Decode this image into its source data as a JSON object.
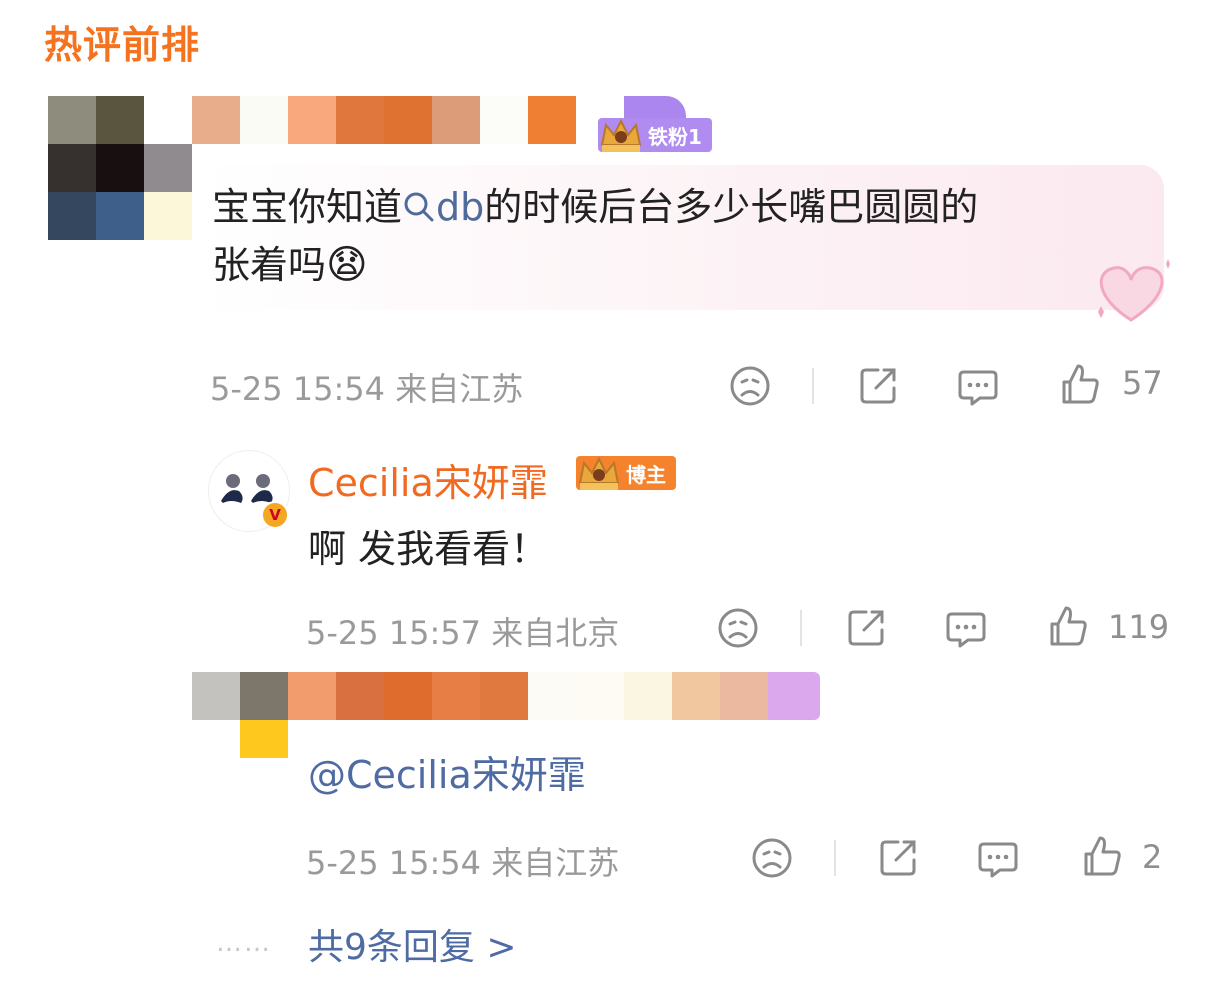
{
  "section_title": "热评前排",
  "comments": [
    {
      "badge_label": "铁粉1",
      "text_before": "宝宝你知道",
      "topic": "db",
      "text_after": "的时候后台多少长嘴巴圆圆的",
      "text_line2": "张着吗",
      "emoji": "😧",
      "time": "5-25 15:54",
      "location": "来自江苏",
      "likes": "57"
    },
    {
      "user_name": "Cecilia宋妍霏",
      "badge_label": "博主",
      "verified_mark": "V",
      "text": "啊 发我看看！",
      "time": "5-25 15:57",
      "location": "来自北京",
      "likes": "119"
    },
    {
      "mention": "@Cecilia宋妍霏",
      "time": "5-25 15:54",
      "location": "来自江苏",
      "likes": "2"
    }
  ],
  "more_replies": {
    "dots": "……",
    "label": "共9条回复 >"
  },
  "icons": {
    "dislike": "sad-face-icon",
    "share": "share-icon",
    "comment": "comment-icon",
    "like": "thumbs-up-icon"
  },
  "colors": {
    "accent_orange": "#f5731f",
    "link_blue": "#4e6ba3",
    "fan_badge": "#b08cf0",
    "host_badge": "#f5822c"
  }
}
